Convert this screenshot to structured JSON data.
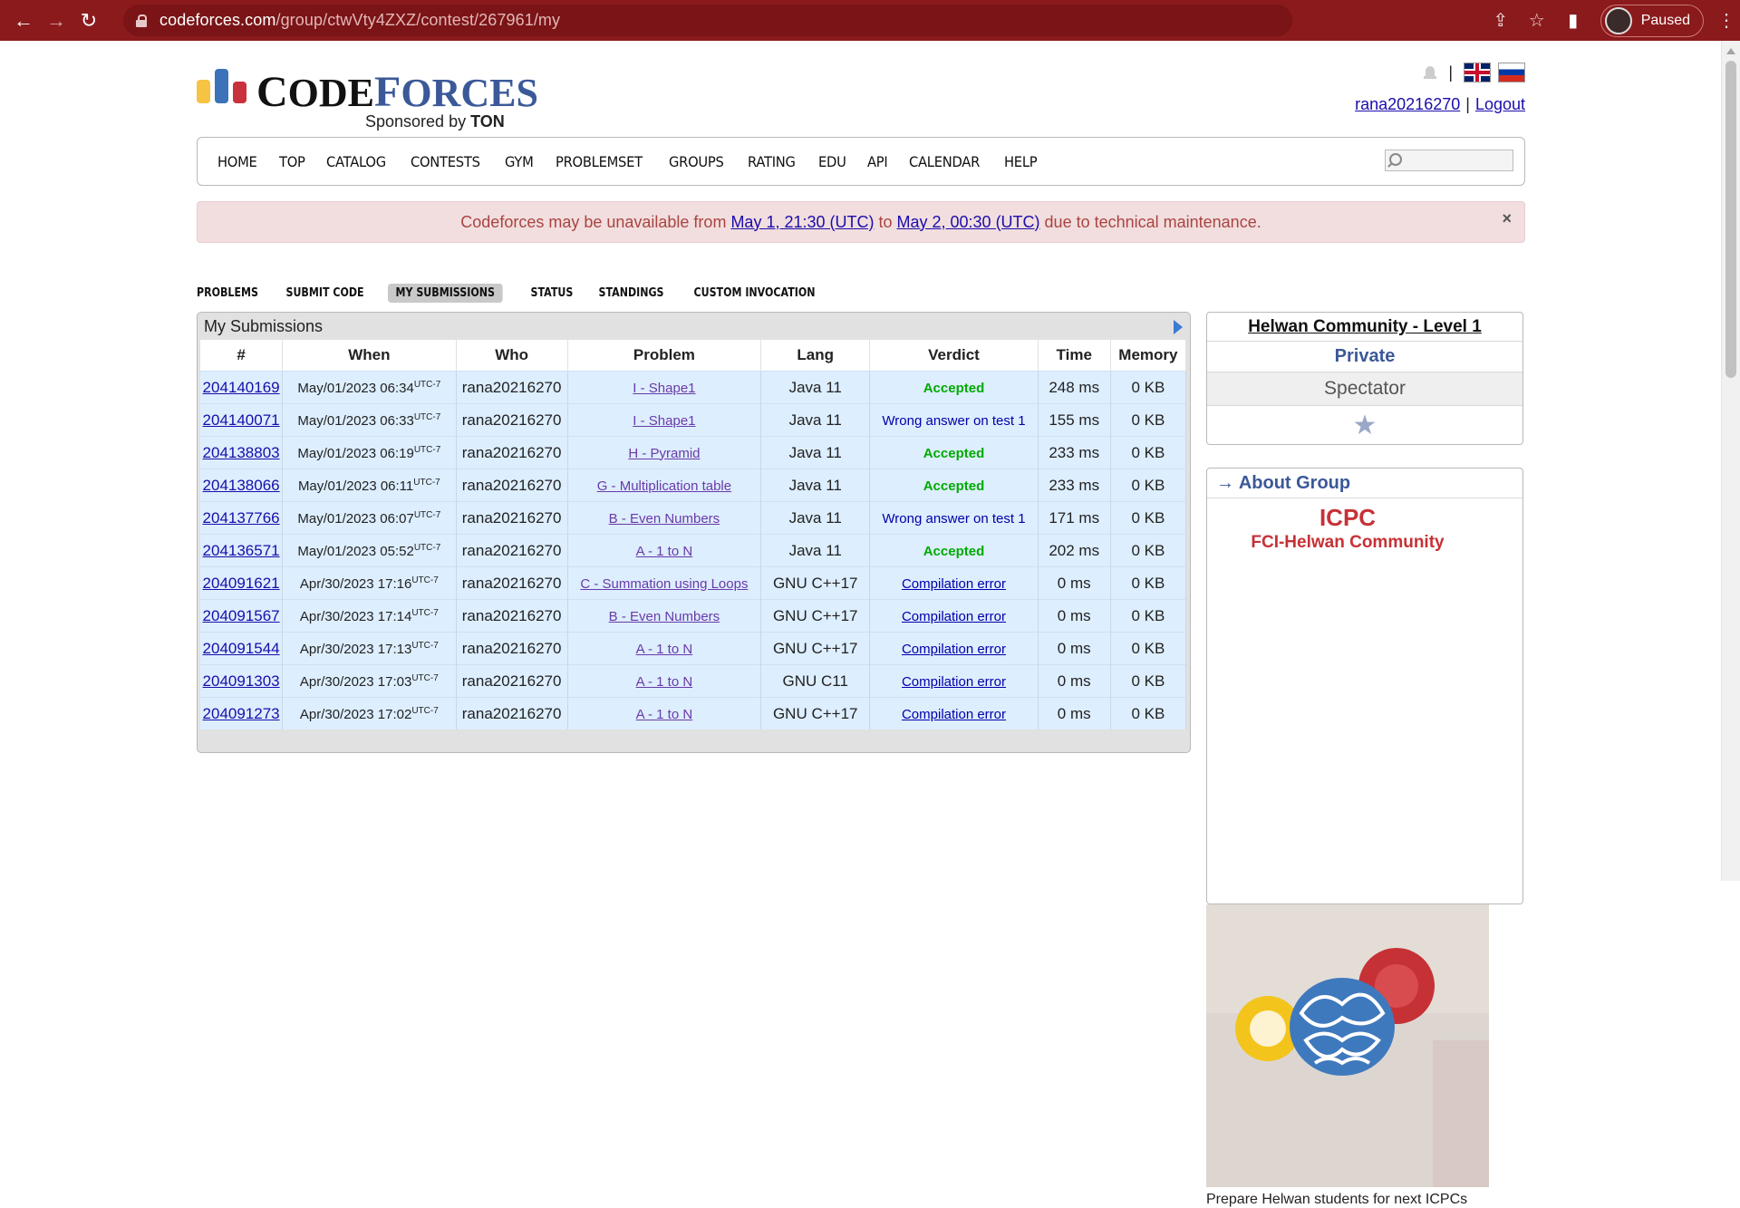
{
  "browser": {
    "url_host": "codeforces.com",
    "url_path": "/group/ctwVty4ZXZ/contest/267961/my",
    "profile_label": "Paused"
  },
  "header": {
    "logo_text_big": "C",
    "logo_text_rest": "ODE",
    "logo_text_blue_big": "F",
    "logo_text_blue_rest": "ORCES",
    "sponsored_prefix": "Sponsored by ",
    "sponsor": "TON",
    "username": "rana20216270",
    "logout": "Logout",
    "separator": "|"
  },
  "menu": [
    "HOME",
    "TOP",
    "CATALOG",
    "CONTESTS",
    "GYM",
    "PROBLEMSET",
    "GROUPS",
    "RATING",
    "EDU",
    "API",
    "CALENDAR",
    "HELP"
  ],
  "alert": {
    "text_before": "Codeforces may be unavailable from",
    "link1": "May 1, 21:30 (UTC)",
    "text_mid": "to",
    "link2": "May 2, 00:30 (UTC)",
    "text_after": "due to technical maintenance.",
    "close": "×"
  },
  "subtabs": [
    "PROBLEMS",
    "SUBMIT CODE",
    "MY SUBMISSIONS",
    "STATUS",
    "STANDINGS",
    "CUSTOM INVOCATION"
  ],
  "submissions": {
    "caption": "My Submissions",
    "columns": [
      "#",
      "When",
      "Who",
      "Problem",
      "Lang",
      "Verdict",
      "Time",
      "Memory"
    ],
    "rows": [
      {
        "id": "204140169",
        "when": "May/01/2023 06:34",
        "tz": "UTC-7",
        "who": "rana20216270",
        "problem": "I - Shape1",
        "lang": "Java 11",
        "verdict": "Accepted",
        "vclass": "acc",
        "time": "248 ms",
        "memory": "0 KB"
      },
      {
        "id": "204140071",
        "when": "May/01/2023 06:33",
        "tz": "UTC-7",
        "who": "rana20216270",
        "problem": "I - Shape1",
        "lang": "Java 11",
        "verdict": "Wrong answer on test 1",
        "vclass": "wa",
        "time": "155 ms",
        "memory": "0 KB"
      },
      {
        "id": "204138803",
        "when": "May/01/2023 06:19",
        "tz": "UTC-7",
        "who": "rana20216270",
        "problem": "H - Pyramid",
        "lang": "Java 11",
        "verdict": "Accepted",
        "vclass": "acc",
        "time": "233 ms",
        "memory": "0 KB"
      },
      {
        "id": "204138066",
        "when": "May/01/2023 06:11",
        "tz": "UTC-7",
        "who": "rana20216270",
        "problem": "G - Multiplication table",
        "lang": "Java 11",
        "verdict": "Accepted",
        "vclass": "acc",
        "time": "233 ms",
        "memory": "0 KB"
      },
      {
        "id": "204137766",
        "when": "May/01/2023 06:07",
        "tz": "UTC-7",
        "who": "rana20216270",
        "problem": "B - Even Numbers",
        "lang": "Java 11",
        "verdict": "Wrong answer on test 1",
        "vclass": "wa",
        "time": "171 ms",
        "memory": "0 KB"
      },
      {
        "id": "204136571",
        "when": "May/01/2023 05:52",
        "tz": "UTC-7",
        "who": "rana20216270",
        "problem": "A - 1 to N",
        "lang": "Java 11",
        "verdict": "Accepted",
        "vclass": "acc",
        "time": "202 ms",
        "memory": "0 KB"
      },
      {
        "id": "204091621",
        "when": "Apr/30/2023 17:16",
        "tz": "UTC-7",
        "who": "rana20216270",
        "problem": "C - Summation using Loops",
        "lang": "GNU C++17",
        "verdict": "Compilation error",
        "vclass": "ce",
        "time": "0 ms",
        "memory": "0 KB"
      },
      {
        "id": "204091567",
        "when": "Apr/30/2023 17:14",
        "tz": "UTC-7",
        "who": "rana20216270",
        "problem": "B - Even Numbers",
        "lang": "GNU C++17",
        "verdict": "Compilation error",
        "vclass": "ce",
        "time": "0 ms",
        "memory": "0 KB"
      },
      {
        "id": "204091544",
        "when": "Apr/30/2023 17:13",
        "tz": "UTC-7",
        "who": "rana20216270",
        "problem": "A - 1 to N",
        "lang": "GNU C++17",
        "verdict": "Compilation error",
        "vclass": "ce",
        "time": "0 ms",
        "memory": "0 KB"
      },
      {
        "id": "204091303",
        "when": "Apr/30/2023 17:03",
        "tz": "UTC-7",
        "who": "rana20216270",
        "problem": "A - 1 to N",
        "lang": "GNU C11",
        "verdict": "Compilation error",
        "vclass": "ce",
        "time": "0 ms",
        "memory": "0 KB"
      },
      {
        "id": "204091273",
        "when": "Apr/30/2023 17:02",
        "tz": "UTC-7",
        "who": "rana20216270",
        "problem": "A - 1 to N",
        "lang": "GNU C++17",
        "verdict": "Compilation error",
        "vclass": "ce",
        "time": "0 ms",
        "memory": "0 KB"
      }
    ]
  },
  "sidebar": {
    "group_title": "Helwan Community - Level 1",
    "privacy": "Private",
    "role": "Spectator",
    "about_title": "→ About Group",
    "image_text_line1": "ICPC",
    "image_text_line2": "FCI-Helwan Community",
    "description": "Prepare Helwan students for next ICPCs"
  },
  "colors": {
    "chrome": "#8b1a1c",
    "accent_blue": "#3b5998",
    "row_blue": "#ddeeff",
    "accepted": "#00aa00",
    "alert_bg": "#f2dede"
  }
}
